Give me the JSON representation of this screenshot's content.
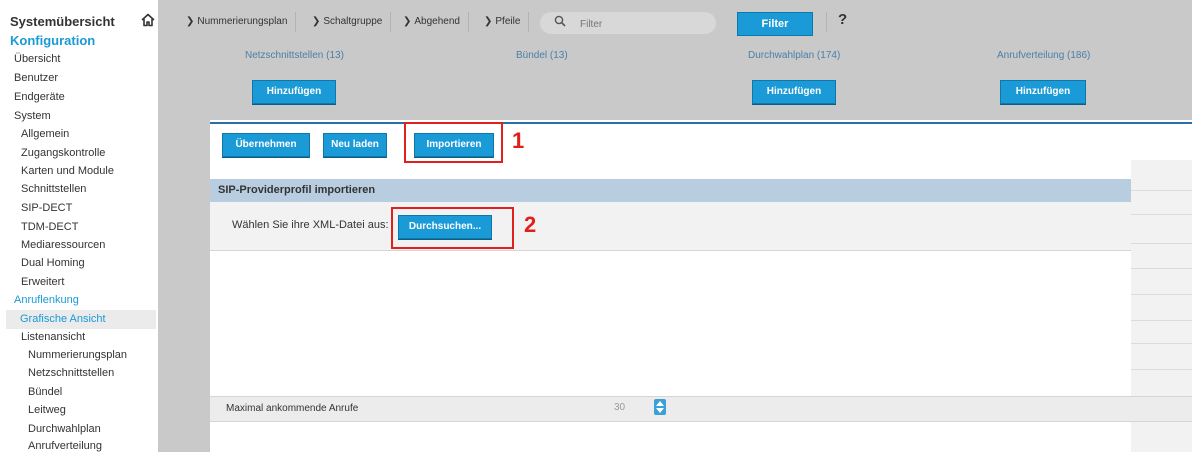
{
  "sidebar": {
    "title": "Systemübersicht",
    "section": "Konfiguration",
    "items": [
      {
        "label": "Übersicht"
      },
      {
        "label": "Benutzer"
      },
      {
        "label": "Endgeräte"
      },
      {
        "label": "System"
      },
      {
        "label": "Allgemein"
      },
      {
        "label": "Zugangskontrolle"
      },
      {
        "label": "Karten und Module"
      },
      {
        "label": "Schnittstellen"
      },
      {
        "label": "SIP-DECT"
      },
      {
        "label": "TDM-DECT"
      },
      {
        "label": "Mediaressourcen"
      },
      {
        "label": "Dual Homing"
      },
      {
        "label": "Erweitert"
      },
      {
        "label": "Anruflenkung"
      },
      {
        "label": "Grafische Ansicht"
      },
      {
        "label": "Listenansicht"
      },
      {
        "label": "Nummerierungsplan"
      },
      {
        "label": "Netzschnittstellen"
      },
      {
        "label": "Bündel"
      },
      {
        "label": "Leitweg"
      },
      {
        "label": "Durchwahlplan"
      },
      {
        "label": "Anrufverteilung"
      }
    ]
  },
  "toolbar": {
    "crumbs": [
      "Nummerierungsplan",
      "Schaltgruppe",
      "Abgehend",
      "Pfeile"
    ],
    "filter_placeholder": "Filter",
    "filter_button": "Filter",
    "help": "?"
  },
  "overview": {
    "links": [
      "Netzschnittstellen (13)",
      "Bündel (13)",
      "Durchwahlplan (174)",
      "Anrufverteilung (186)"
    ],
    "add_label": "Hinzufügen"
  },
  "actions": {
    "apply": "Übernehmen",
    "reload": "Neu laden",
    "import": "Importieren"
  },
  "import_section": {
    "title": "SIP-Providerprofil importieren",
    "file_label": "Wählen Sie ihre XML-Datei aus:",
    "browse": "Durchsuchen..."
  },
  "max_calls": {
    "label": "Maximal ankommende Anrufe",
    "value": "30"
  },
  "annotations": {
    "marker1": "1",
    "marker2": "2"
  },
  "colors": {
    "accent": "#1a9ad6",
    "annotation": "#e0201c",
    "section_header": "#b9cde0"
  }
}
